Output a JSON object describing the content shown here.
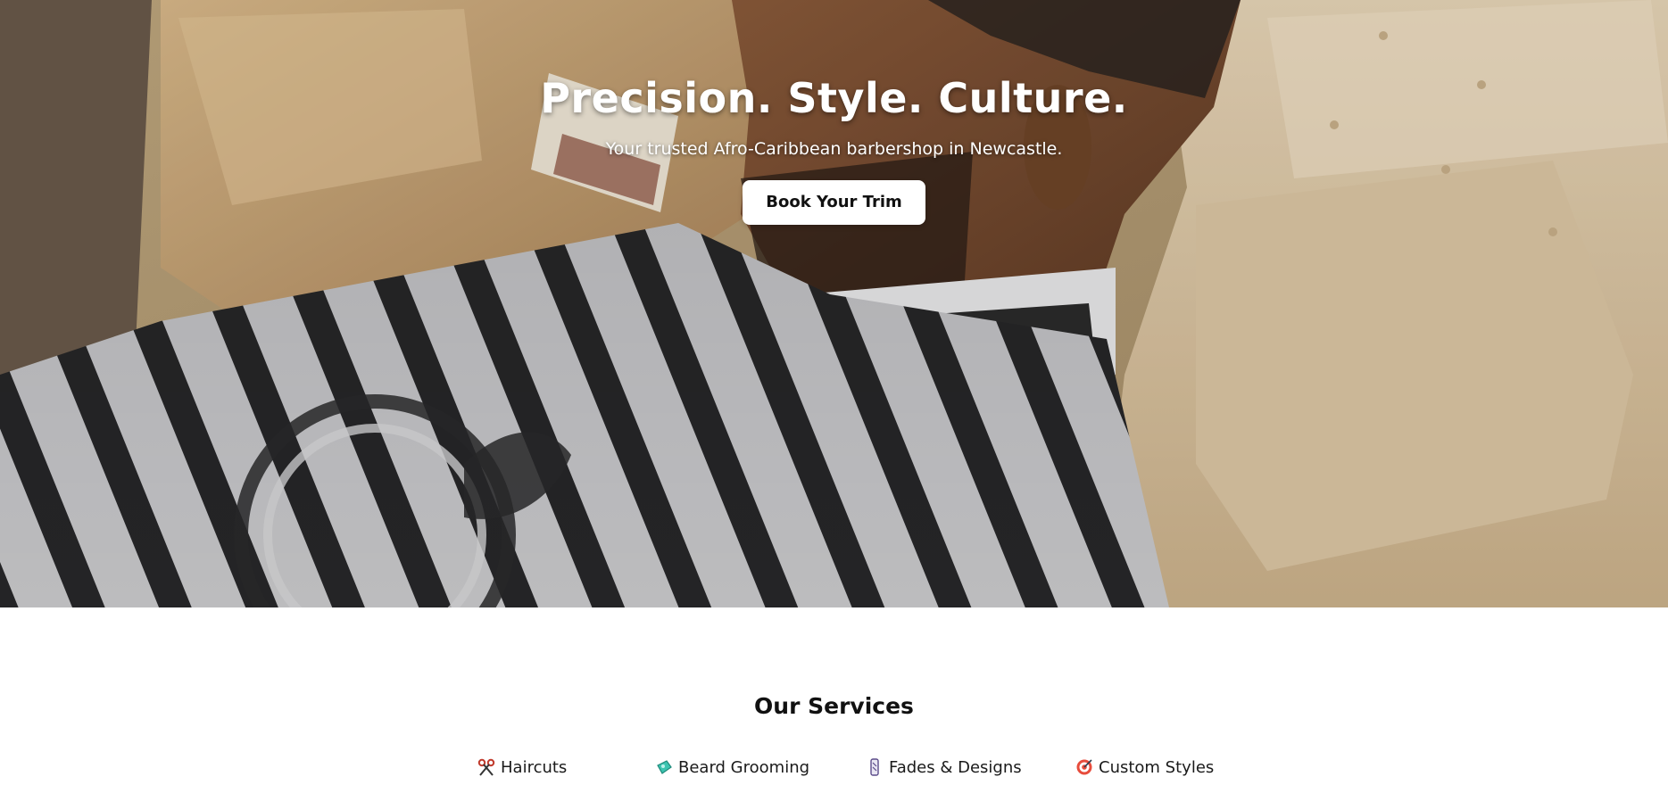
{
  "hero": {
    "title": "Precision. Style. Culture.",
    "subtitle": "Your trusted Afro-Caribbean barbershop in Newcastle.",
    "cta_label": "Book Your Trim"
  },
  "services": {
    "title": "Our Services",
    "items": [
      {
        "label": "Haircuts",
        "icon": "scissors-icon"
      },
      {
        "label": "Beard Grooming",
        "icon": "soap-icon"
      },
      {
        "label": "Fades & Designs",
        "icon": "razor-icon"
      },
      {
        "label": "Custom Styles",
        "icon": "target-icon"
      }
    ]
  },
  "colors": {
    "hero_text": "#ffffff",
    "cta_background": "#ffffff",
    "cta_text": "#111111",
    "section_background": "#ffffff"
  }
}
